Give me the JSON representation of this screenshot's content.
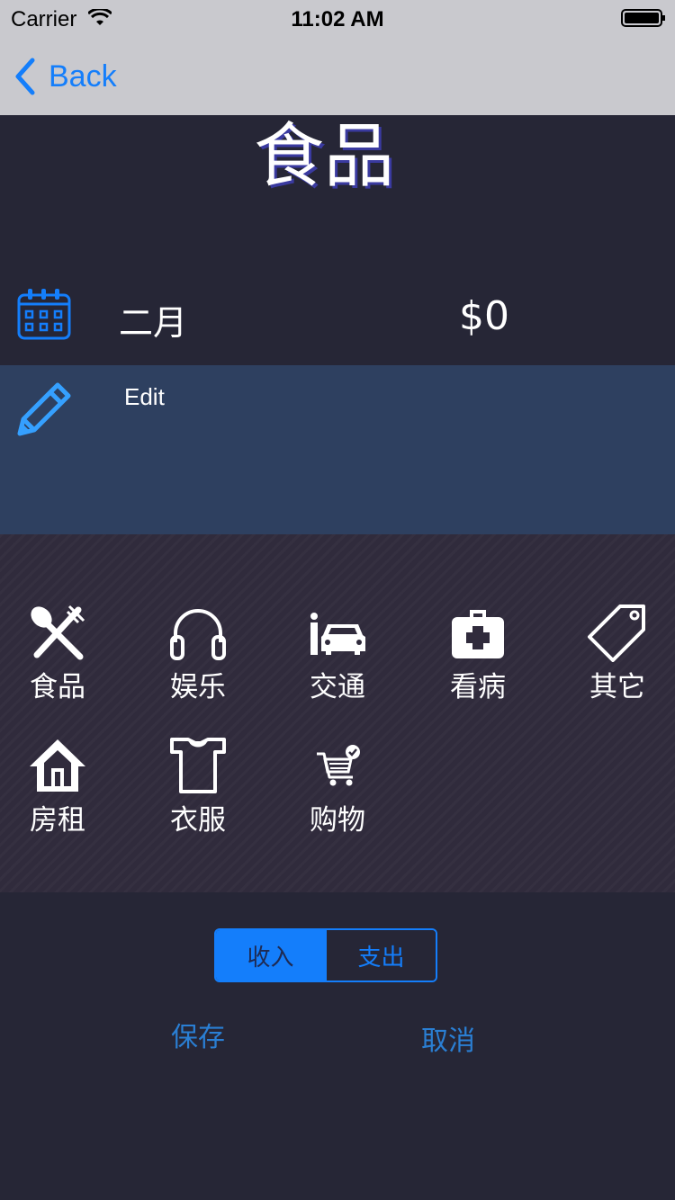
{
  "status_bar": {
    "carrier": "Carrier",
    "time": "11:02 AM"
  },
  "nav": {
    "back_label": "Back"
  },
  "title": "食品",
  "entry": {
    "month": "二月",
    "amount": "$0"
  },
  "edit": {
    "label": "Edit"
  },
  "categories": [
    {
      "label": "食品",
      "icon": "fork-spoon-icon"
    },
    {
      "label": "娱乐",
      "icon": "headphones-icon"
    },
    {
      "label": "交通",
      "icon": "car-icon"
    },
    {
      "label": "看病",
      "icon": "first-aid-kit-icon"
    },
    {
      "label": "其它",
      "icon": "tag-icon"
    },
    {
      "label": "房租",
      "icon": "house-icon"
    },
    {
      "label": "衣服",
      "icon": "tshirt-icon"
    },
    {
      "label": "购物",
      "icon": "shopping-cart-icon"
    }
  ],
  "segment": {
    "options": [
      "收入",
      "支出"
    ],
    "selected": "收入"
  },
  "actions": {
    "save": "保存",
    "cancel": "取消"
  },
  "colors": {
    "accent": "#147efb",
    "background": "#262636",
    "edit_panel": "#2e4060",
    "grid": "#302b3c"
  }
}
